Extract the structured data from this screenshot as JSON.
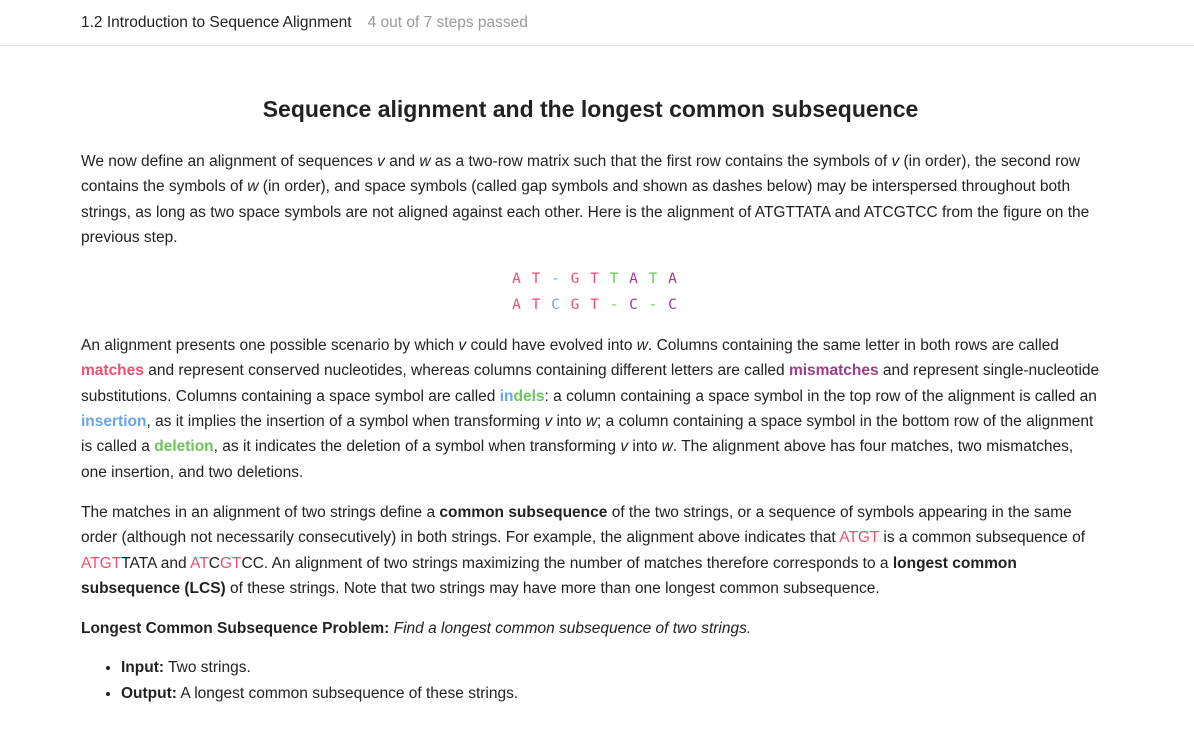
{
  "header": {
    "lesson_title": "1.2 Introduction to Sequence Alignment",
    "progress_text": "4 out of 7 steps passed"
  },
  "heading": "Sequence alignment and the longest common subsequence",
  "para1": {
    "t1": "We now define an alignment of sequences ",
    "v": "v",
    "t2": " and ",
    "w": "w",
    "t3": " as a two-row matrix such that the first row contains the symbols of ",
    "t4": " (in order), the second row contains the symbols of ",
    "t5": " (in order), and space symbols (called gap symbols and shown as dashes below) may be interspersed throughout both strings, as long as two space symbols are not aligned against each other. Here is the alignment of ATGTTATA and ATCGTCC from the figure on the previous step."
  },
  "alignment": {
    "top": [
      "A",
      "T",
      "-",
      "G",
      "T",
      "T",
      "A",
      "T",
      "A"
    ],
    "bottom": [
      "A",
      "T",
      "C",
      "G",
      "T",
      "-",
      "C",
      "-",
      "C"
    ],
    "colors": {
      "match": "#f0506e",
      "mismatch": "#9c3d86",
      "insertion": "#6aa6e6",
      "deletion": "#6cc45a"
    }
  },
  "para2": {
    "t1": "An alignment presents one possible scenario by which ",
    "t2": " could have evolved into ",
    "t3": ". Columns containing the same letter in both rows are called ",
    "matches": "matches",
    "t4": " and represent conserved nucleotides, whereas columns containing different letters are called ",
    "mismatches": "mismatches",
    "t5": " and represent single-nucleotide substitutions. Columns containing a space symbol are called ",
    "indels_in": "in",
    "indels_dels": "dels",
    "t6": ": a column containing a space symbol in the top row of the alignment is called an ",
    "insertion": "insertion",
    "t7": ", as it implies the insertion of a symbol when transforming ",
    "t8": " into ",
    "t9": "; a column containing a space symbol in the bottom row of the alignment is called a ",
    "deletion": "deletion",
    "t10": ", as it indicates the deletion of a symbol when transforming ",
    "t11": ". The alignment above has four matches, two mismatches, one insertion, and two deletions."
  },
  "para3": {
    "t1": "The matches in an alignment of two strings define a ",
    "common_subsequence": "common subsequence",
    "t2": " of the two strings, or a sequence of symbols appearing in the same order (although not necessarily consecutively) in both strings. For example, the alignment above indicates that ",
    "atgt": "ATGT",
    "t3": " is a common subsequence of ",
    "s1_a": "ATGT",
    "s1_b": "TATA",
    "t4": " and ",
    "s2_a": "AT",
    "s2_b": "C",
    "s2_c": "GT",
    "s2_d": "CC",
    "t5": ". An alignment of two strings maximizing the number of matches therefore corresponds to a ",
    "lcs": "longest common subsequence (LCS)",
    "t6": " of these strings. Note that two strings may have more than one longest common subsequence."
  },
  "problem": {
    "label": "Longest Common Subsequence Problem:",
    "statement": "Find a longest common subsequence of two strings."
  },
  "io": [
    {
      "label": "Input:",
      "text": " Two strings."
    },
    {
      "label": "Output:",
      "text": " A longest common subsequence of these strings."
    }
  ]
}
